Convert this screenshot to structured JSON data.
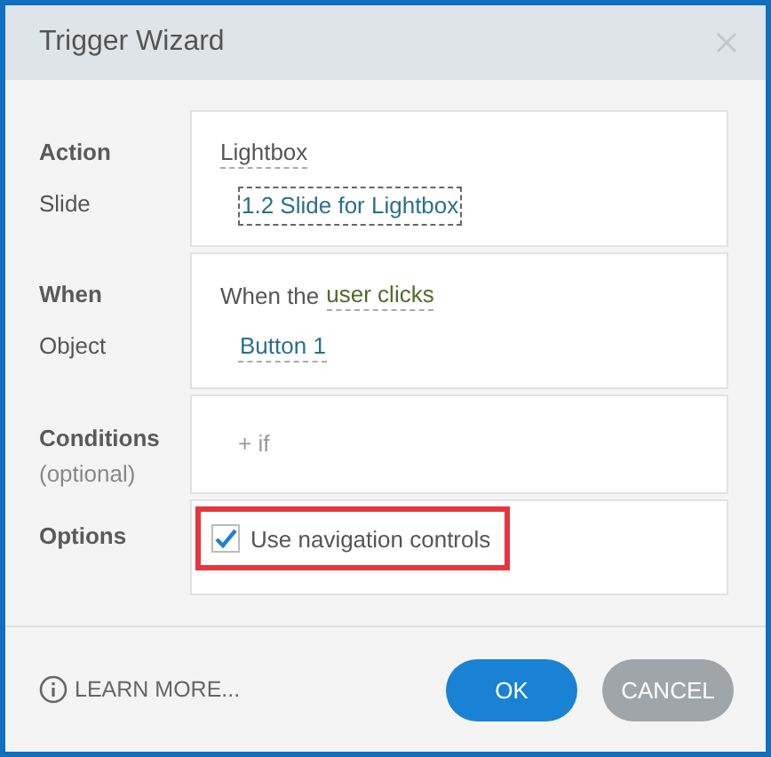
{
  "window": {
    "title": "Trigger Wizard"
  },
  "sections": [
    {
      "labels": [
        {
          "text": "Action",
          "kind": "heading"
        },
        {
          "text": "Slide",
          "kind": "plain"
        }
      ],
      "rows": [
        [
          {
            "kind": "choice",
            "text": "Lightbox"
          }
        ],
        [
          {
            "kind": "link",
            "text": "1.2 Slide for Lightbox",
            "focused": true
          }
        ]
      ]
    },
    {
      "labels": [
        {
          "text": "When",
          "kind": "heading"
        },
        {
          "text": "Object",
          "kind": "plain"
        }
      ],
      "rows": [
        [
          {
            "kind": "plain",
            "text": "When the"
          },
          {
            "kind": "keyword",
            "text": "user clicks"
          }
        ],
        [
          {
            "kind": "link",
            "text": "Button 1",
            "focused": false
          }
        ]
      ]
    },
    {
      "labels": [
        {
          "text": "Conditions",
          "kind": "heading"
        },
        {
          "text": "(optional)",
          "kind": "note"
        }
      ],
      "rows": [
        [
          {
            "kind": "add",
            "text": "+ if"
          }
        ]
      ]
    },
    {
      "labels": [
        {
          "text": "Options",
          "kind": "heading"
        }
      ],
      "rows": [
        [
          {
            "kind": "checkbox",
            "text": "Use navigation controls",
            "checked": true,
            "highlighted": true
          }
        ]
      ]
    }
  ],
  "footer": {
    "learn_more": "LEARN MORE...",
    "buttons": [
      {
        "label": "OK",
        "kind": "primary"
      },
      {
        "label": "CANCEL",
        "kind": "secondary"
      }
    ]
  }
}
